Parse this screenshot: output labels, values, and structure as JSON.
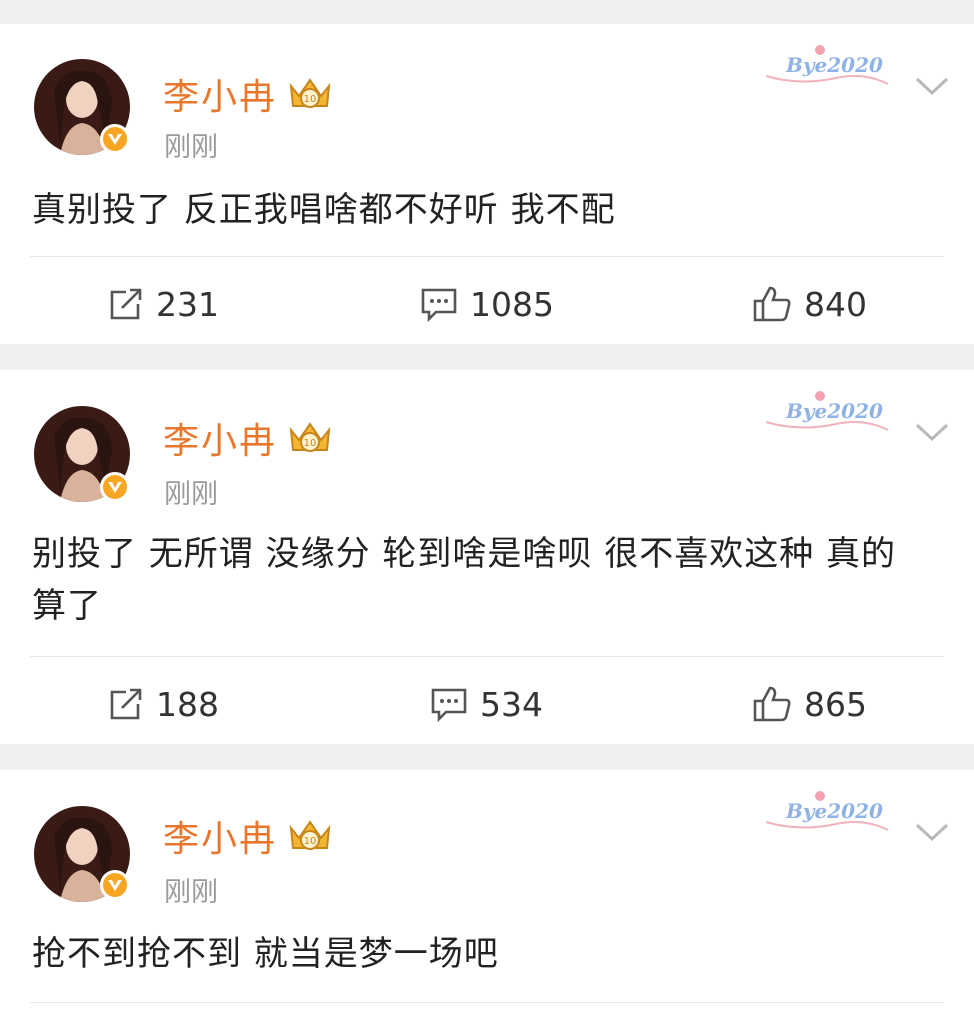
{
  "posts": [
    {
      "author": "李小冉",
      "time": "刚刚",
      "badge_text": "Bye2020",
      "text": "真别投了 反正我唱啥都不好听 我不配",
      "reposts": "231",
      "comments": "1085",
      "likes": "840"
    },
    {
      "author": "李小冉",
      "time": "刚刚",
      "badge_text": "Bye2020",
      "text": "别投了 无所谓 没缘分 轮到啥是啥呗 很不喜欢这种 真的  算了",
      "reposts": "188",
      "comments": "534",
      "likes": "865"
    },
    {
      "author": "李小冉",
      "time": "刚刚",
      "badge_text": "Bye2020",
      "text": "抢不到抢不到 就当是梦一场吧"
    }
  ],
  "colors": {
    "author": "#e8762d",
    "verified": "#f6a623",
    "muted": "#9a9a9a",
    "background": "#efefef"
  },
  "icons": {
    "repost": "repost-icon",
    "comment": "comment-icon",
    "like": "like-icon",
    "chevron": "chevron-down-icon",
    "verified": "verified-badge-icon",
    "vip": "vip-crown-icon"
  }
}
